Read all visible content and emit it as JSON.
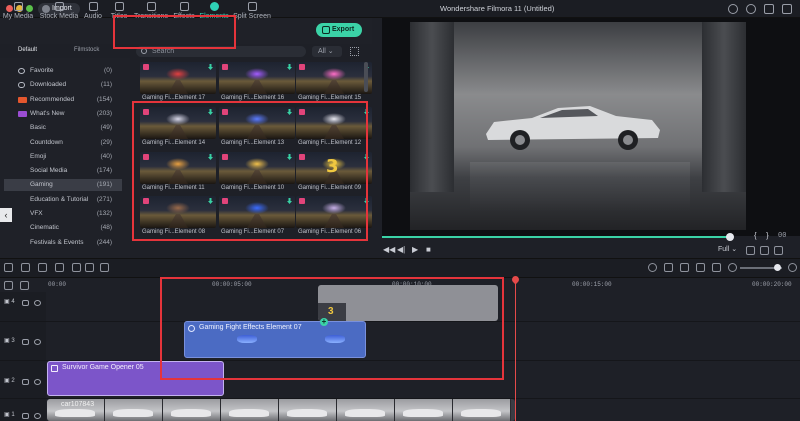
{
  "window": {
    "app_title": "Wondershare Filmora 11 (Untitled)",
    "import_label": "Import",
    "export_label": "Export"
  },
  "tabs": [
    {
      "label": "My Media",
      "icon": "folder-icon"
    },
    {
      "label": "Stock Media",
      "icon": "stock-icon"
    },
    {
      "label": "Audio",
      "icon": "music-icon"
    },
    {
      "label": "Titles",
      "icon": "text-icon"
    },
    {
      "label": "Transitions",
      "icon": "transition-icon"
    },
    {
      "label": "Effects",
      "icon": "sparkle-icon"
    },
    {
      "label": "Elements",
      "icon": "elements-icon",
      "active": true
    },
    {
      "label": "Split Screen",
      "icon": "split-screen-icon"
    }
  ],
  "subheader": {
    "default_label": "Default",
    "filmstock_label": "Filmstock",
    "search_placeholder": "Search",
    "filter_value": "All"
  },
  "categories": [
    {
      "label": "Favorite",
      "count": "(0)",
      "icon": "heart-icon"
    },
    {
      "label": "Downloaded",
      "count": "(11)",
      "icon": "cloud-icon"
    },
    {
      "label": "Recommended",
      "count": "(154)",
      "icon": "hot-badge"
    },
    {
      "label": "What's New",
      "count": "(203)",
      "icon": "new-badge"
    },
    {
      "label": "Basic",
      "count": "(49)"
    },
    {
      "label": "Countdown",
      "count": "(29)"
    },
    {
      "label": "Emoji",
      "count": "(40)"
    },
    {
      "label": "Social Media",
      "count": "(174)"
    },
    {
      "label": "Gaming",
      "count": "(191)",
      "selected": true
    },
    {
      "label": "Education & Tutorial",
      "count": "(271)"
    },
    {
      "label": "VFX",
      "count": "(132)"
    },
    {
      "label": "Cinematic",
      "count": "(48)"
    },
    {
      "label": "Festivals & Events",
      "count": "(244)"
    }
  ],
  "thumbnails": [
    {
      "caption": "Gaming Fi...Element 17",
      "glow": "#e04040"
    },
    {
      "caption": "Gaming Fi...Element 16",
      "glow": "#a45cff"
    },
    {
      "caption": "Gaming Fi...Element 15",
      "glow": "#ff6ec7"
    },
    {
      "caption": "Gaming Fi...Element 14",
      "glow": "#d8d8e8"
    },
    {
      "caption": "Gaming Fi...Element 13",
      "glow": "#5b7bff"
    },
    {
      "caption": "Gaming Fi...Element 12",
      "glow": "#e8e8f0"
    },
    {
      "caption": "Gaming Fi...Element 11",
      "glow": "#e8a040"
    },
    {
      "caption": "Gaming Fi...Element 10",
      "glow": "#f2c14a"
    },
    {
      "caption": "Gaming Fi...Element 09",
      "glow": "#f0c840",
      "text": "3"
    },
    {
      "caption": "Gaming Fi...Element 08",
      "glow": "#9a6a4a"
    },
    {
      "caption": "Gaming Fi...Element 07",
      "glow": "#3b6cff"
    },
    {
      "caption": "Gaming Fi...Element 06",
      "glow": "#c8b0e8"
    }
  ],
  "preview": {
    "timecode": "00",
    "quality": "Full",
    "progress": 0.99
  },
  "timeline": {
    "ruler_labels": [
      "00:00",
      "00:00:05:00",
      "00:00:10:00",
      "00:00:15:00",
      "00:00:20:00"
    ],
    "tracks": [
      {
        "label": "4"
      },
      {
        "label": "3"
      },
      {
        "label": "2"
      },
      {
        "label": "1"
      }
    ],
    "clips": {
      "element": "Gaming Fight Effects Element 07",
      "title": "Survivor Game Opener 05",
      "video": "car107843",
      "gray_label": "3"
    },
    "zoom": 0.8
  },
  "colors": {
    "accent": "#3bd3a7",
    "annotation": "#e5343b",
    "element_clip": "#4b6bc3",
    "title_clip": "#7c55c9",
    "playhead": "#e54a4a"
  }
}
